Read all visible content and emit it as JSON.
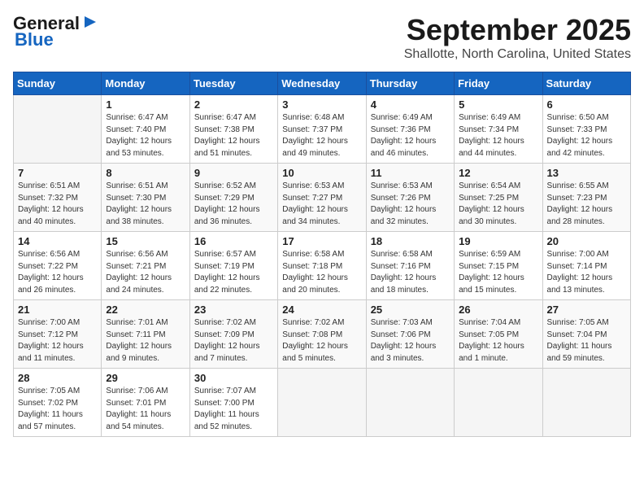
{
  "logo": {
    "line1": "General",
    "line2": "Blue"
  },
  "header": {
    "month": "September 2025",
    "location": "Shallotte, North Carolina, United States"
  },
  "weekdays": [
    "Sunday",
    "Monday",
    "Tuesday",
    "Wednesday",
    "Thursday",
    "Friday",
    "Saturday"
  ],
  "weeks": [
    [
      {
        "day": "",
        "info": ""
      },
      {
        "day": "1",
        "info": "Sunrise: 6:47 AM\nSunset: 7:40 PM\nDaylight: 12 hours\nand 53 minutes."
      },
      {
        "day": "2",
        "info": "Sunrise: 6:47 AM\nSunset: 7:38 PM\nDaylight: 12 hours\nand 51 minutes."
      },
      {
        "day": "3",
        "info": "Sunrise: 6:48 AM\nSunset: 7:37 PM\nDaylight: 12 hours\nand 49 minutes."
      },
      {
        "day": "4",
        "info": "Sunrise: 6:49 AM\nSunset: 7:36 PM\nDaylight: 12 hours\nand 46 minutes."
      },
      {
        "day": "5",
        "info": "Sunrise: 6:49 AM\nSunset: 7:34 PM\nDaylight: 12 hours\nand 44 minutes."
      },
      {
        "day": "6",
        "info": "Sunrise: 6:50 AM\nSunset: 7:33 PM\nDaylight: 12 hours\nand 42 minutes."
      }
    ],
    [
      {
        "day": "7",
        "info": "Sunrise: 6:51 AM\nSunset: 7:32 PM\nDaylight: 12 hours\nand 40 minutes."
      },
      {
        "day": "8",
        "info": "Sunrise: 6:51 AM\nSunset: 7:30 PM\nDaylight: 12 hours\nand 38 minutes."
      },
      {
        "day": "9",
        "info": "Sunrise: 6:52 AM\nSunset: 7:29 PM\nDaylight: 12 hours\nand 36 minutes."
      },
      {
        "day": "10",
        "info": "Sunrise: 6:53 AM\nSunset: 7:27 PM\nDaylight: 12 hours\nand 34 minutes."
      },
      {
        "day": "11",
        "info": "Sunrise: 6:53 AM\nSunset: 7:26 PM\nDaylight: 12 hours\nand 32 minutes."
      },
      {
        "day": "12",
        "info": "Sunrise: 6:54 AM\nSunset: 7:25 PM\nDaylight: 12 hours\nand 30 minutes."
      },
      {
        "day": "13",
        "info": "Sunrise: 6:55 AM\nSunset: 7:23 PM\nDaylight: 12 hours\nand 28 minutes."
      }
    ],
    [
      {
        "day": "14",
        "info": "Sunrise: 6:56 AM\nSunset: 7:22 PM\nDaylight: 12 hours\nand 26 minutes."
      },
      {
        "day": "15",
        "info": "Sunrise: 6:56 AM\nSunset: 7:21 PM\nDaylight: 12 hours\nand 24 minutes."
      },
      {
        "day": "16",
        "info": "Sunrise: 6:57 AM\nSunset: 7:19 PM\nDaylight: 12 hours\nand 22 minutes."
      },
      {
        "day": "17",
        "info": "Sunrise: 6:58 AM\nSunset: 7:18 PM\nDaylight: 12 hours\nand 20 minutes."
      },
      {
        "day": "18",
        "info": "Sunrise: 6:58 AM\nSunset: 7:16 PM\nDaylight: 12 hours\nand 18 minutes."
      },
      {
        "day": "19",
        "info": "Sunrise: 6:59 AM\nSunset: 7:15 PM\nDaylight: 12 hours\nand 15 minutes."
      },
      {
        "day": "20",
        "info": "Sunrise: 7:00 AM\nSunset: 7:14 PM\nDaylight: 12 hours\nand 13 minutes."
      }
    ],
    [
      {
        "day": "21",
        "info": "Sunrise: 7:00 AM\nSunset: 7:12 PM\nDaylight: 12 hours\nand 11 minutes."
      },
      {
        "day": "22",
        "info": "Sunrise: 7:01 AM\nSunset: 7:11 PM\nDaylight: 12 hours\nand 9 minutes."
      },
      {
        "day": "23",
        "info": "Sunrise: 7:02 AM\nSunset: 7:09 PM\nDaylight: 12 hours\nand 7 minutes."
      },
      {
        "day": "24",
        "info": "Sunrise: 7:02 AM\nSunset: 7:08 PM\nDaylight: 12 hours\nand 5 minutes."
      },
      {
        "day": "25",
        "info": "Sunrise: 7:03 AM\nSunset: 7:06 PM\nDaylight: 12 hours\nand 3 minutes."
      },
      {
        "day": "26",
        "info": "Sunrise: 7:04 AM\nSunset: 7:05 PM\nDaylight: 12 hours\nand 1 minute."
      },
      {
        "day": "27",
        "info": "Sunrise: 7:05 AM\nSunset: 7:04 PM\nDaylight: 11 hours\nand 59 minutes."
      }
    ],
    [
      {
        "day": "28",
        "info": "Sunrise: 7:05 AM\nSunset: 7:02 PM\nDaylight: 11 hours\nand 57 minutes."
      },
      {
        "day": "29",
        "info": "Sunrise: 7:06 AM\nSunset: 7:01 PM\nDaylight: 11 hours\nand 54 minutes."
      },
      {
        "day": "30",
        "info": "Sunrise: 7:07 AM\nSunset: 7:00 PM\nDaylight: 11 hours\nand 52 minutes."
      },
      {
        "day": "",
        "info": ""
      },
      {
        "day": "",
        "info": ""
      },
      {
        "day": "",
        "info": ""
      },
      {
        "day": "",
        "info": ""
      }
    ]
  ]
}
